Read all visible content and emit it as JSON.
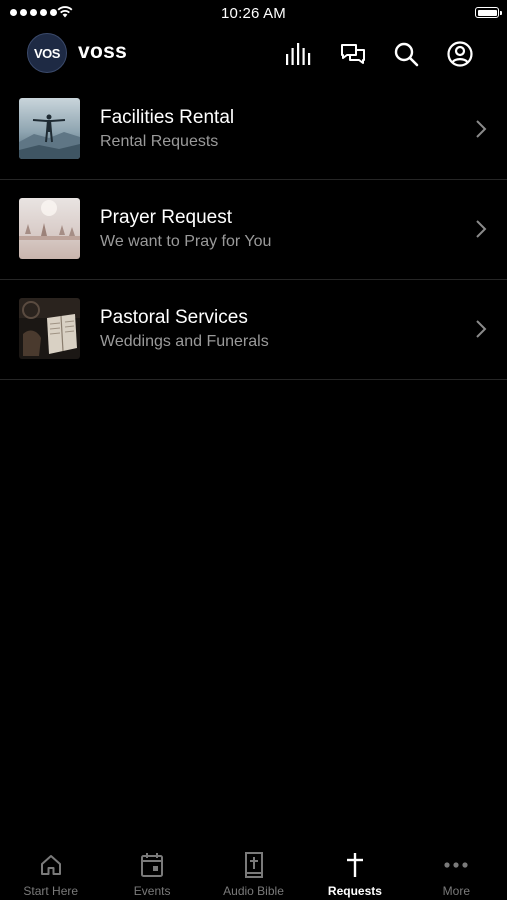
{
  "status_bar": {
    "time": "10:26 AM",
    "signal_icon": "cellular-dots-icon",
    "wifi_icon": "wifi-icon",
    "battery_icon": "battery-icon"
  },
  "header": {
    "logo_text": "VOS",
    "brand": "voss",
    "actions": [
      {
        "name": "audio-bars-icon"
      },
      {
        "name": "chat-bubbles-icon"
      },
      {
        "name": "search-icon"
      },
      {
        "name": "profile-icon"
      }
    ]
  },
  "requests": [
    {
      "title": "Facilities Rental",
      "subtitle": "Rental Requests"
    },
    {
      "title": "Prayer Request",
      "subtitle": "We want to Pray for You"
    },
    {
      "title": "Pastoral Services",
      "subtitle": "Weddings and Funerals"
    }
  ],
  "tab_bar": {
    "tabs": [
      {
        "label": "Start Here",
        "icon": "home-icon"
      },
      {
        "label": "Events",
        "icon": "calendar-icon"
      },
      {
        "label": "Audio Bible",
        "icon": "bible-icon"
      },
      {
        "label": "Requests",
        "icon": "cross-icon"
      },
      {
        "label": "More",
        "icon": "more-dots-icon"
      }
    ],
    "active_index": 3
  },
  "colors": {
    "background": "#000000",
    "text_primary": "#ffffff",
    "text_secondary": "#9a9a9a",
    "divider": "#262626",
    "tab_inactive": "#7a7a7a"
  }
}
